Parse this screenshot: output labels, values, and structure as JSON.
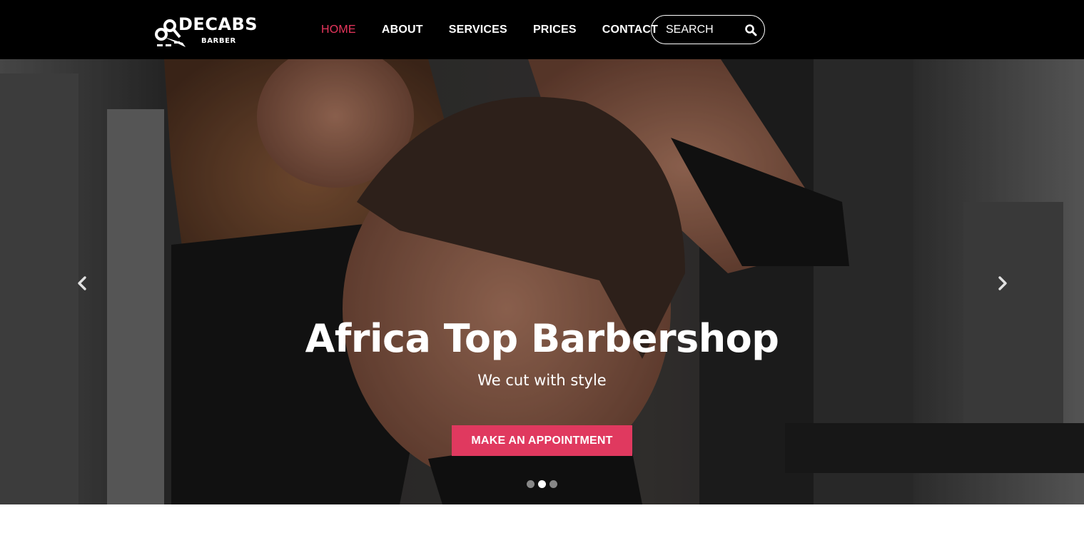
{
  "brand": {
    "name": "DECABS",
    "tagline": "BARBER"
  },
  "nav": {
    "items": [
      {
        "label": "HOME",
        "active": true
      },
      {
        "label": "ABOUT"
      },
      {
        "label": "SERVICES"
      },
      {
        "label": "PRICES"
      },
      {
        "label": "CONTACT"
      }
    ]
  },
  "search": {
    "placeholder": "SEARCH",
    "icon": "search-icon"
  },
  "hero": {
    "title": "Africa Top Barbershop",
    "subtitle": "We cut with style",
    "cta_label": "MAKE AN APPOINTMENT",
    "prev_icon": "chevron-left-icon",
    "next_icon": "chevron-right-icon",
    "slide_count": 3,
    "active_slide": 2
  },
  "colors": {
    "header_bg": "#000000",
    "accent": "#e8365d",
    "cta_bg": "#e0395f",
    "text": "#ffffff"
  }
}
